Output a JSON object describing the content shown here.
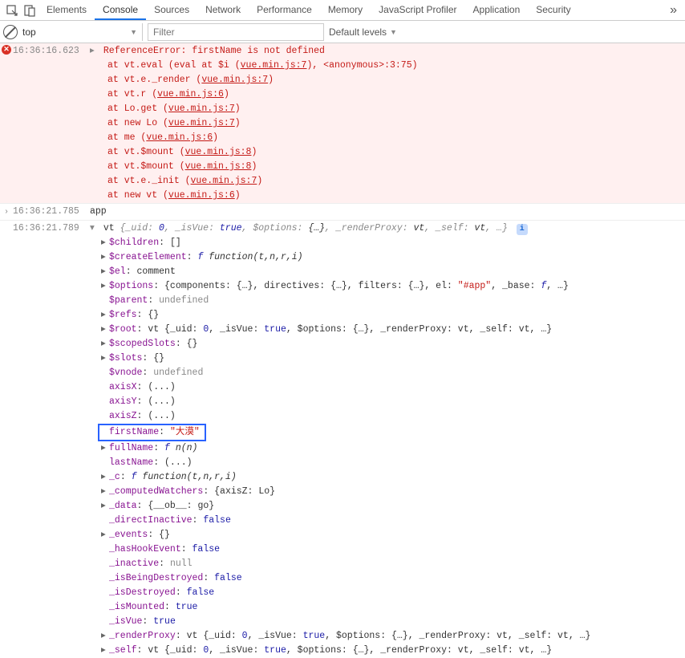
{
  "tabs": [
    "Elements",
    "Console",
    "Sources",
    "Network",
    "Performance",
    "Memory",
    "JavaScript Profiler",
    "Application",
    "Security"
  ],
  "active_tab": "Console",
  "context": "top",
  "filter_placeholder": "Filter",
  "levels_label": "Default levels",
  "error": {
    "ts": "16:36:16.623",
    "title": "ReferenceError: firstName is not defined",
    "stack": [
      {
        "pre": "at vt.eval (eval at $i (",
        "file": "vue.min.js:7",
        "post": "), <anonymous>:3:75)"
      },
      {
        "pre": "at vt.e._render (",
        "file": "vue.min.js:7",
        "post": ")"
      },
      {
        "pre": "at vt.r (",
        "file": "vue.min.js:6",
        "post": ")"
      },
      {
        "pre": "at Lo.get (",
        "file": "vue.min.js:7",
        "post": ")"
      },
      {
        "pre": "at new Lo (",
        "file": "vue.min.js:7",
        "post": ")"
      },
      {
        "pre": "at me (",
        "file": "vue.min.js:6",
        "post": ")"
      },
      {
        "pre": "at vt.$mount (",
        "file": "vue.min.js:8",
        "post": ")"
      },
      {
        "pre": "at vt.$mount (",
        "file": "vue.min.js:8",
        "post": ")"
      },
      {
        "pre": "at vt.e._init (",
        "file": "vue.min.js:7",
        "post": ")"
      },
      {
        "pre": "at new vt (",
        "file": "vue.min.js:6",
        "post": ")"
      }
    ]
  },
  "log1": {
    "ts": "16:36:21.785",
    "text": "app"
  },
  "obj": {
    "ts": "16:36:21.789",
    "summary_prefix": "vt ",
    "summary_parts": [
      {
        "k": "_uid",
        "v": "0",
        "t": "num"
      },
      {
        "k": "_isVue",
        "v": "true",
        "t": "bool"
      },
      {
        "k": "$options",
        "v": "{…}",
        "t": "obj"
      },
      {
        "k": "_renderProxy",
        "v": "vt",
        "t": "obj"
      },
      {
        "k": "_self",
        "v": "vt",
        "t": "obj"
      }
    ],
    "props": [
      {
        "caret": true,
        "key": "$children",
        "val": "[]",
        "t": "plain"
      },
      {
        "caret": true,
        "key": "$createElement",
        "val": "f function(t,n,r,i)",
        "t": "fn"
      },
      {
        "caret": true,
        "key": "$el",
        "val": "comment",
        "t": "plain"
      },
      {
        "caret": true,
        "key": "$options",
        "val": "{components: {…}, directives: {…}, filters: {…}, el: \"#app\", _base: f, …}",
        "t": "mixed"
      },
      {
        "caret": false,
        "key": "$parent",
        "val": "undefined",
        "t": "gray"
      },
      {
        "caret": true,
        "key": "$refs",
        "val": "{}",
        "t": "plain"
      },
      {
        "caret": true,
        "key": "$root",
        "val": "vt {_uid: 0, _isVue: true, $options: {…}, _renderProxy: vt, _self: vt, …}",
        "t": "mixed"
      },
      {
        "caret": true,
        "key": "$scopedSlots",
        "val": "{}",
        "t": "plain"
      },
      {
        "caret": true,
        "key": "$slots",
        "val": "{}",
        "t": "plain"
      },
      {
        "caret": false,
        "key": "$vnode",
        "val": "undefined",
        "t": "gray"
      },
      {
        "caret": false,
        "key": "axisX",
        "val": "(...)",
        "t": "plain"
      },
      {
        "caret": false,
        "key": "axisY",
        "val": "(...)",
        "t": "plain"
      },
      {
        "caret": false,
        "key": "axisZ",
        "val": "(...)",
        "t": "plain",
        "partial": true
      },
      {
        "caret": false,
        "key": "firstName",
        "val": "\"大漠\"",
        "t": "str",
        "highlight": true
      },
      {
        "caret": true,
        "key": "fullName",
        "val": "f n(n)",
        "t": "fn"
      },
      {
        "caret": false,
        "key": "lastName",
        "val": "(...)",
        "t": "plain"
      },
      {
        "caret": true,
        "key": "_c",
        "val": "f function(t,n,r,i)",
        "t": "fn"
      },
      {
        "caret": true,
        "key": "_computedWatchers",
        "val": "{axisZ: Lo}",
        "t": "plain"
      },
      {
        "caret": true,
        "key": "_data",
        "val": "{__ob__: go}",
        "t": "plain"
      },
      {
        "caret": false,
        "key": "_directInactive",
        "val": "false",
        "t": "bool"
      },
      {
        "caret": true,
        "key": "_events",
        "val": "{}",
        "t": "plain"
      },
      {
        "caret": false,
        "key": "_hasHookEvent",
        "val": "false",
        "t": "bool"
      },
      {
        "caret": false,
        "key": "_inactive",
        "val": "null",
        "t": "gray"
      },
      {
        "caret": false,
        "key": "_isBeingDestroyed",
        "val": "false",
        "t": "bool"
      },
      {
        "caret": false,
        "key": "_isDestroyed",
        "val": "false",
        "t": "bool"
      },
      {
        "caret": false,
        "key": "_isMounted",
        "val": "true",
        "t": "bool"
      },
      {
        "caret": false,
        "key": "_isVue",
        "val": "true",
        "t": "bool"
      },
      {
        "caret": true,
        "key": "_renderProxy",
        "val": "vt {_uid: 0, _isVue: true, $options: {…}, _renderProxy: vt, _self: vt, …}",
        "t": "mixed"
      },
      {
        "caret": true,
        "key": "_self",
        "val": "vt {_uid: 0, _isVue: true, $options: {…}, _renderProxy: vt, _self: vt, …}",
        "t": "mixed"
      }
    ]
  }
}
